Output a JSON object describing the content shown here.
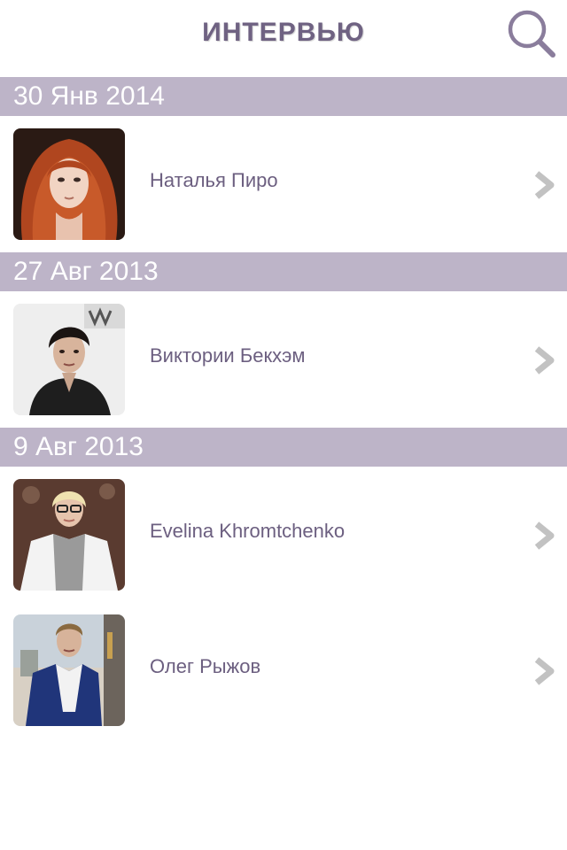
{
  "header": {
    "title": "ИНТЕРВЬЮ",
    "search_icon": "search-icon"
  },
  "sections": [
    {
      "date": "30 Янв 2014",
      "items": [
        {
          "name": "Наталья Пиро",
          "thumb": "red-haired-woman-portrait"
        }
      ]
    },
    {
      "date": "27 Авг 2013",
      "items": [
        {
          "name": "Виктории Бекхэм",
          "thumb": "dark-haired-woman-portrait"
        }
      ]
    },
    {
      "date": "9 Авг 2013",
      "items": [
        {
          "name": "Evelina Khromtchenko",
          "thumb": "blonde-woman-with-glasses-portrait"
        },
        {
          "name": "Олег Рыжов",
          "thumb": "man-in-blue-suit-portrait"
        }
      ]
    }
  ],
  "colors": {
    "accent": "#6f6282",
    "section_bg": "#bdb4c8",
    "text": "#6c5f80",
    "chevron": "#bfbfbf"
  }
}
